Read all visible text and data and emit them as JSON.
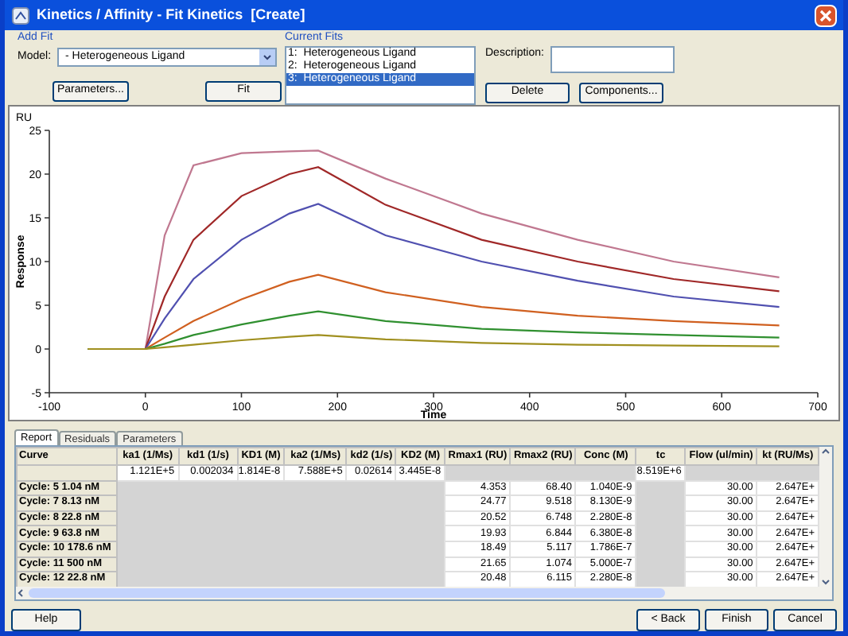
{
  "window": {
    "title": "Kinetics / Affinity - Fit Kinetics  [Create]"
  },
  "add_fit": {
    "title": "Add Fit",
    "model_label": "Model:",
    "model_value": "-  Heterogeneous Ligand",
    "buttons": [
      "Parameters...",
      "Fit"
    ]
  },
  "current_fits": {
    "title": "Current Fits",
    "items": [
      {
        "label": "1:  Heterogeneous Ligand",
        "selected": false
      },
      {
        "label": "2:  Heterogeneous Ligand",
        "selected": false
      },
      {
        "label": "3:  Heterogeneous Ligand",
        "selected": true
      }
    ]
  },
  "description": {
    "label": "Description:"
  },
  "fit_buttons": [
    "Delete",
    "Components..."
  ],
  "chart": {
    "unit": "RU",
    "chart_data": {
      "type": "line",
      "xlabel": "Time",
      "ylabel": "Response",
      "x": [
        -60,
        0,
        20,
        50,
        100,
        150,
        180,
        250,
        350,
        450,
        550,
        660
      ],
      "xlim": [
        -100,
        700
      ],
      "ylim": [
        -5,
        25
      ],
      "xticks": [
        -100,
        0,
        100,
        200,
        300,
        400,
        500,
        600,
        700
      ],
      "yticks": [
        -5,
        0,
        5,
        10,
        15,
        20,
        25
      ],
      "series": [
        {
          "color": "#c07890",
          "values": [
            0,
            0,
            13,
            21,
            22.4,
            22.6,
            22.7,
            19.5,
            15.5,
            12.5,
            10,
            8.2
          ]
        },
        {
          "color": "#a02828",
          "values": [
            0,
            0,
            6,
            12.5,
            17.5,
            20,
            20.8,
            16.5,
            12.5,
            10,
            8,
            6.6
          ]
        },
        {
          "color": "#5050b0",
          "values": [
            0,
            0,
            3.5,
            8,
            12.5,
            15.5,
            16.6,
            13,
            10,
            7.8,
            6,
            4.8
          ]
        },
        {
          "color": "#d06020",
          "values": [
            0,
            0,
            1.3,
            3.2,
            5.7,
            7.7,
            8.5,
            6.5,
            4.8,
            3.8,
            3.2,
            2.7
          ]
        },
        {
          "color": "#309030",
          "values": [
            0,
            0,
            0.6,
            1.6,
            2.8,
            3.8,
            4.3,
            3.2,
            2.3,
            1.9,
            1.6,
            1.3
          ]
        },
        {
          "color": "#a09020",
          "values": [
            0,
            0,
            0.2,
            0.5,
            1.0,
            1.4,
            1.6,
            1.1,
            0.7,
            0.5,
            0.4,
            0.3
          ]
        }
      ]
    }
  },
  "tabs": [
    {
      "label": "Report",
      "selected": true
    },
    {
      "label": "Residuals",
      "selected": false
    },
    {
      "label": "Parameters",
      "selected": false
    }
  ],
  "table": {
    "columns": [
      "Curve",
      "ka1 (1/Ms)",
      "kd1 (1/s)",
      "KD1 (M)",
      "ka2 (1/Ms)",
      "kd2 (1/s)",
      "KD2 (M)",
      "Rmax1 (RU)",
      "Rmax2 (RU)",
      "Conc (M)",
      "tc",
      "Flow (ul/min)",
      "kt (RU/Ms)"
    ],
    "rows": [
      [
        null,
        "1.121E+5",
        "0.002034",
        "1.814E-8",
        "7.588E+5",
        "0.02614",
        "3.445E-8",
        null,
        null,
        null,
        "8.519E+6",
        null,
        null
      ],
      [
        "Cycle: 5  1.04 nM",
        null,
        null,
        null,
        null,
        null,
        null,
        "4.353",
        "68.40",
        "1.040E-9",
        null,
        "30.00",
        "2.647E+"
      ],
      [
        "Cycle: 7  8.13 nM",
        null,
        null,
        null,
        null,
        null,
        null,
        "24.77",
        "9.518",
        "8.130E-9",
        null,
        "30.00",
        "2.647E+"
      ],
      [
        "Cycle: 8  22.8 nM",
        null,
        null,
        null,
        null,
        null,
        null,
        "20.52",
        "6.748",
        "2.280E-8",
        null,
        "30.00",
        "2.647E+"
      ],
      [
        "Cycle: 9  63.8 nM",
        null,
        null,
        null,
        null,
        null,
        null,
        "19.93",
        "6.844",
        "6.380E-8",
        null,
        "30.00",
        "2.647E+"
      ],
      [
        "Cycle: 10  178.6 nM",
        null,
        null,
        null,
        null,
        null,
        null,
        "18.49",
        "5.117",
        "1.786E-7",
        null,
        "30.00",
        "2.647E+"
      ],
      [
        "Cycle: 11  500 nM",
        null,
        null,
        null,
        null,
        null,
        null,
        "21.65",
        "1.074",
        "5.000E-7",
        null,
        "30.00",
        "2.647E+"
      ],
      [
        "Cycle: 12  22.8 nM",
        null,
        null,
        null,
        null,
        null,
        null,
        "20.48",
        "6.115",
        "2.280E-8",
        null,
        "30.00",
        "2.647E+"
      ]
    ]
  },
  "footer_buttons": {
    "left": [
      "Help"
    ],
    "right": [
      "< Back",
      "Finish",
      "Cancel"
    ]
  }
}
